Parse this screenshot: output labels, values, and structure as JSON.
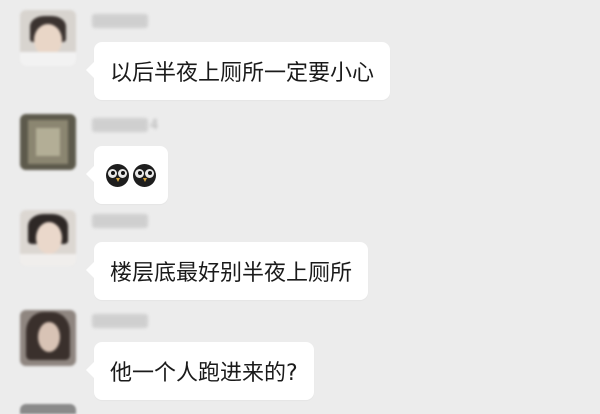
{
  "messages": [
    {
      "sender": "",
      "name_suffix": "",
      "text": "以后半夜上厕所一定要小心"
    },
    {
      "sender": "",
      "name_suffix": "4",
      "emojis": [
        "owl-icon",
        "owl-icon"
      ]
    },
    {
      "sender": "",
      "name_suffix": "",
      "text": "楼层底最好别半夜上厕所"
    },
    {
      "sender": "",
      "name_suffix": "",
      "text": "他一个人跑进来的?"
    }
  ],
  "colors": {
    "background": "#ececec",
    "bubble": "#ffffff",
    "text": "#1a1a1a"
  }
}
